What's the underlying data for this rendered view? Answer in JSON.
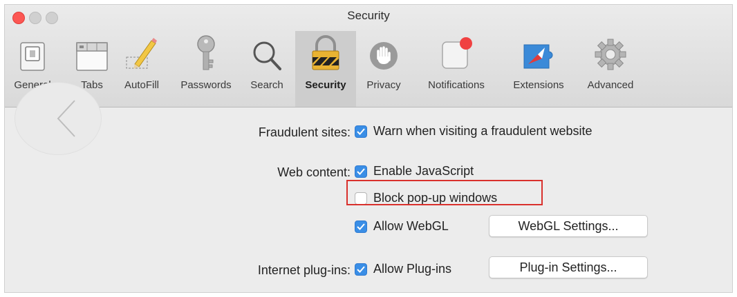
{
  "window": {
    "title": "Security"
  },
  "toolbar": {
    "items": [
      {
        "label": "General",
        "icon": "general-switch-icon"
      },
      {
        "label": "Tabs",
        "icon": "tabs-icon"
      },
      {
        "label": "AutoFill",
        "icon": "pencil-icon"
      },
      {
        "label": "Passwords",
        "icon": "key-icon"
      },
      {
        "label": "Search",
        "icon": "magnifier-icon"
      },
      {
        "label": "Security",
        "icon": "padlock-icon",
        "selected": true
      },
      {
        "label": "Privacy",
        "icon": "hand-icon"
      },
      {
        "label": "Notifications",
        "icon": "notification-badge-icon"
      },
      {
        "label": "Extensions",
        "icon": "compass-puzzle-icon"
      },
      {
        "label": "Advanced",
        "icon": "gear-icon"
      }
    ]
  },
  "settings": {
    "fraudulent_label": "Fraudulent sites:",
    "fraudulent_option": {
      "label": "Warn when visiting a fraudulent website",
      "checked": true
    },
    "web_content_label": "Web content:",
    "javascript_option": {
      "label": "Enable JavaScript",
      "checked": true
    },
    "popup_option": {
      "label": "Block pop-up windows",
      "checked": false
    },
    "webgl_option": {
      "label": "Allow WebGL",
      "checked": true
    },
    "webgl_button": "WebGL Settings...",
    "plugins_label": "Internet plug-ins:",
    "plugins_option": {
      "label": "Allow Plug-ins",
      "checked": true
    },
    "plugins_button": "Plug-in Settings..."
  },
  "colors": {
    "accent": "#3a8ee6",
    "highlight": "#d9302c",
    "close": "#fc5753"
  }
}
